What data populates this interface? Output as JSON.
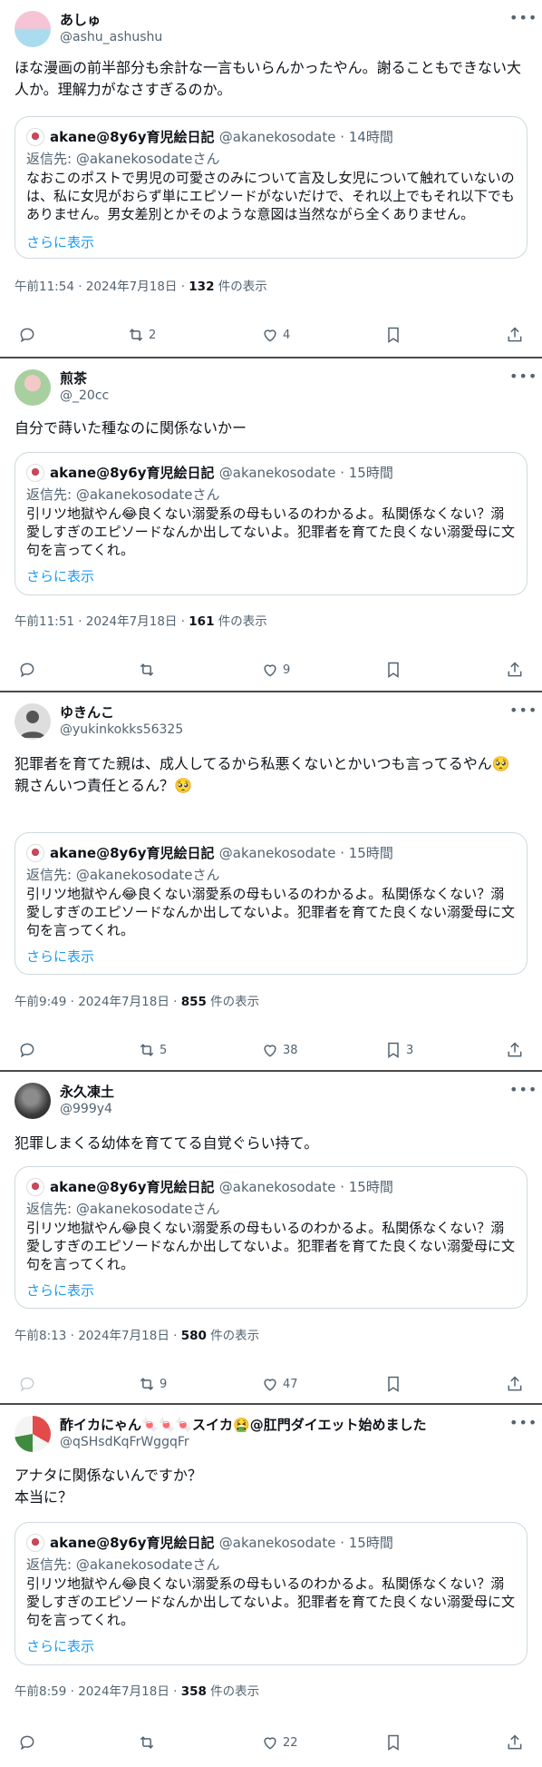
{
  "tweets": [
    {
      "name": "あしゅ",
      "handle": "@ashu_ashushu",
      "text": "ほな漫画の前半部分も余計な一言もいらんかったやん。謝ることもできない大人か。理解力がなさすぎるのか。",
      "quote": {
        "name": "akane@8y6y育児絵日記",
        "meta": "@akanekosodate · 14時間",
        "reply": "返信先: @akanekosodateさん",
        "text": "なおこのポストで男児の可愛さのみについて言及し女児について触れていないのは、私に女児がおらず単にエピソードがないだけで、それ以上でもそれ以下でもありません。男女差別とかそのような意図は当然ながら全くありません。",
        "more": "さらに表示"
      },
      "time": "午前11:54 · 2024年7月18日 · ",
      "views": "132",
      "views_suffix": " 件の表示",
      "replies": "",
      "retweets": "2",
      "likes": "4",
      "bookmarks": ""
    },
    {
      "name": "煎茶",
      "handle": "@_20cc",
      "text": "自分で蒔いた種なのに関係ないかー",
      "quote": {
        "name": "akane@8y6y育児絵日記",
        "meta": "@akanekosodate · 15時間",
        "reply": "返信先: @akanekosodateさん",
        "text": "引リツ地獄やん😂良くない溺愛系の母もいるのわかるよ。私関係なくない？溺愛しすぎのエピソードなんか出してないよ。犯罪者を育てた良くない溺愛母に文句を言ってくれ。",
        "more": "さらに表示"
      },
      "time": "午前11:51 · 2024年7月18日 · ",
      "views": "161",
      "views_suffix": " 件の表示",
      "replies": "",
      "retweets": "",
      "likes": "9",
      "bookmarks": ""
    },
    {
      "name": "ゆきんこ",
      "handle": "@yukinkokks56325",
      "text": "犯罪者を育てた親は、成人してるから私悪くないとかいつも言ってるやん🥺\n親さんいつ責任とるん？🥺",
      "quote": {
        "name": "akane@8y6y育児絵日記",
        "meta": "@akanekosodate · 15時間",
        "reply": "返信先: @akanekosodateさん",
        "text": "引リツ地獄やん😂良くない溺愛系の母もいるのわかるよ。私関係なくない？溺愛しすぎのエピソードなんか出してないよ。犯罪者を育てた良くない溺愛母に文句を言ってくれ。",
        "more": "さらに表示"
      },
      "time": "午前9:49 · 2024年7月18日 · ",
      "views": "855",
      "views_suffix": " 件の表示",
      "replies": "",
      "retweets": "5",
      "likes": "38",
      "bookmarks": "3"
    },
    {
      "name": "永久凍土",
      "handle": "@999y4",
      "text": "犯罪しまくる幼体を育ててる自覚ぐらい持て。",
      "quote": {
        "name": "akane@8y6y育児絵日記",
        "meta": "@akanekosodate · 15時間",
        "reply": "返信先: @akanekosodateさん",
        "text": "引リツ地獄やん😂良くない溺愛系の母もいるのわかるよ。私関係なくない？溺愛しすぎのエピソードなんか出してないよ。犯罪者を育てた良くない溺愛母に文句を言ってくれ。",
        "more": "さらに表示"
      },
      "time": "午前8:13 · 2024年7月18日 · ",
      "views": "580",
      "views_suffix": " 件の表示",
      "replies": "",
      "retweets": "9",
      "likes": "47",
      "bookmarks": ""
    },
    {
      "name": "酢イカにゃん🍬🍬🍬スイカ🤮@肛門ダイエット始めました",
      "handle": "@qSHsdKqFrWggqFr",
      "text": "アナタに関係ないんですか？\n本当に？",
      "quote": {
        "name": "akane@8y6y育児絵日記",
        "meta": "@akanekosodate · 15時間",
        "reply": "返信先: @akanekosodateさん",
        "text": "引リツ地獄やん😂良くない溺愛系の母もいるのわかるよ。私関係なくない？溺愛しすぎのエピソードなんか出してないよ。犯罪者を育てた良くない溺愛母に文句を言ってくれ。",
        "more": "さらに表示"
      },
      "time": "午前8:59 · 2024年7月18日 · ",
      "views": "358",
      "views_suffix": " 件の表示",
      "replies": "",
      "retweets": "",
      "likes": "22",
      "bookmarks": ""
    }
  ],
  "icons": [
    "more-icon",
    "reply-icon",
    "retweet-icon",
    "like-icon",
    "bookmark-icon",
    "share-icon"
  ],
  "colors": {
    "link": "#1d9bf0",
    "muted": "#536471",
    "border": "#cfd9de"
  }
}
